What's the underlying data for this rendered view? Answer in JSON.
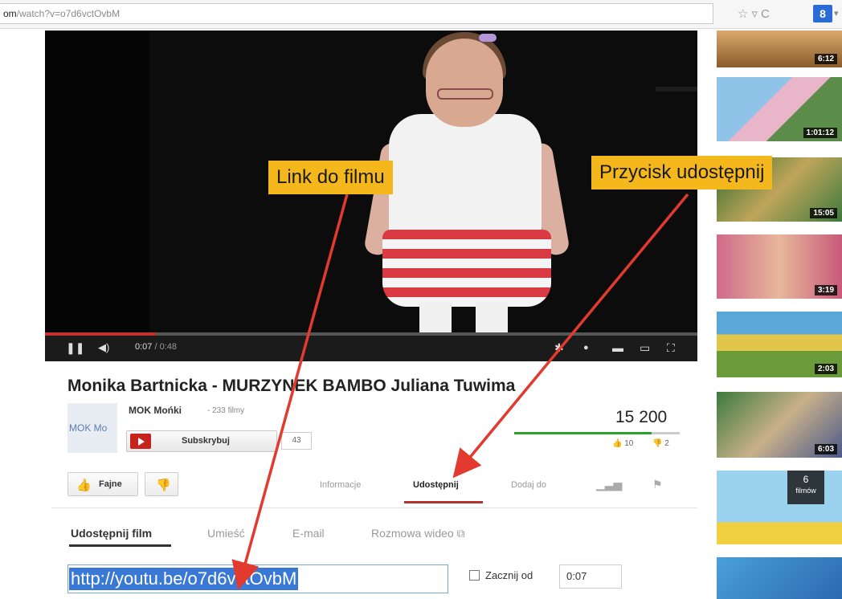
{
  "browser": {
    "url_prefix": "om",
    "url_rest": "/watch?v=o7d6vctOvbM",
    "star_icon": "star-icon",
    "reload_icon": "reload-icon",
    "gplus_label": "8"
  },
  "player": {
    "current_time": "0:07",
    "duration": "/ 0:48",
    "progress_fraction": 0.17,
    "play_state": "paused"
  },
  "callouts": {
    "link": "Link do filmu",
    "share": "Przycisk udostępnij"
  },
  "video": {
    "title": "Monika Bartnicka - MURZYNEK BAMBO Juliana Tuwima",
    "channel_thumb": "MOK Mo",
    "channel_name": "MOK Mońki",
    "channel_videos": "- 233 filmy",
    "subscribe_label": "Subskrybuj",
    "subscriber_count": "43",
    "views": "15 200",
    "likes": "10",
    "dislikes": "2",
    "like_fraction": 0.83
  },
  "actions": {
    "like_label": "Fajne",
    "tabs": [
      "Informacje",
      "Udostępnij",
      "Dodaj do"
    ],
    "active_tab": "Udostępnij"
  },
  "share": {
    "tabs": [
      "Udostępnij film",
      "Umieść",
      "E-mail",
      "Rozmowa wideo ⧉"
    ],
    "active_tab": "Udostępnij film",
    "link": "http://youtu.be/o7d6vctOvbM",
    "start_label": "Zacznij od",
    "start_value": "0:07",
    "start_checked": false
  },
  "sidebar": {
    "durations": [
      "6:12",
      "1:01:12",
      "15:05",
      "3:19",
      "2:03",
      "6:03"
    ],
    "playlist_count": "6",
    "playlist_label": "filmów"
  },
  "colors": {
    "callout": "#f5b81c",
    "arrow": "#e23a2f",
    "accent_red": "#c4302b",
    "link_highlight": "#3a78d6"
  }
}
